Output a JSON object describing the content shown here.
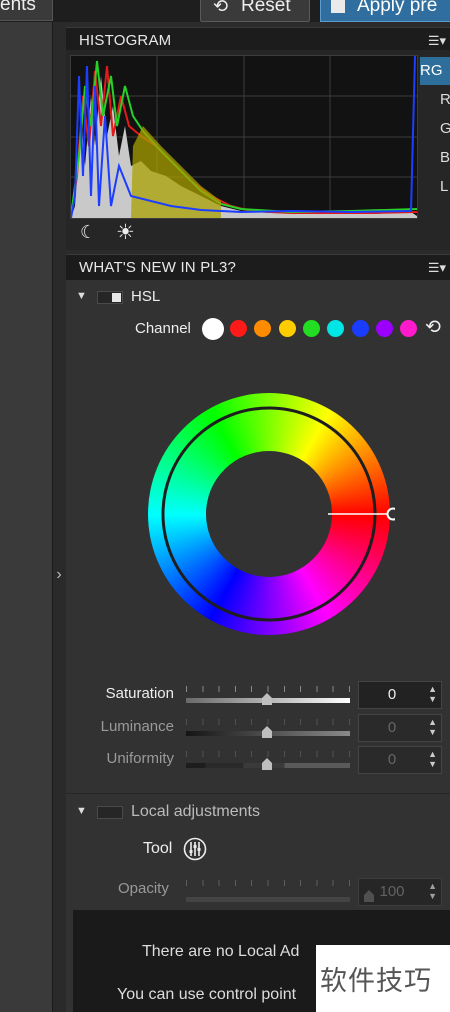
{
  "topbar": {
    "left_tab_label": "ents",
    "reset_label": "Reset",
    "reset_icon": "reset-arrow-icon",
    "apply_label": "Apply pre",
    "apply_icon": "document-icon"
  },
  "sidebar": {
    "expand_icon": "chevron-right-icon"
  },
  "histogram": {
    "title": "HISTOGRAM",
    "menu_icon": "panel-menu-icon",
    "channels": [
      "RG",
      "R",
      "G",
      "B",
      "L"
    ],
    "selected_channel": "RG",
    "shadow_clip_icon": "moon-icon",
    "highlight_clip_icon": "sun-icon"
  },
  "whats_new": {
    "title": "WHAT'S NEW IN PL3?",
    "menu_icon": "panel-menu-icon",
    "hsl": {
      "label": "HSL",
      "channel_label": "Channel",
      "channels": [
        {
          "name": "all",
          "color": "#ffffff"
        },
        {
          "name": "red",
          "color": "#ff1a1a"
        },
        {
          "name": "orange",
          "color": "#ff8c00"
        },
        {
          "name": "yellow",
          "color": "#ffcc00"
        },
        {
          "name": "green",
          "color": "#22dd22"
        },
        {
          "name": "cyan",
          "color": "#00e5e5"
        },
        {
          "name": "blue",
          "color": "#1a3cff"
        },
        {
          "name": "purple",
          "color": "#9b00ff"
        },
        {
          "name": "magenta",
          "color": "#ff1acb"
        }
      ],
      "selected_channel": "all",
      "reset_icon": "undo-icon",
      "sliders": [
        {
          "label": "Saturation",
          "value": "0",
          "enabled": true
        },
        {
          "label": "Luminance",
          "value": "0",
          "enabled": false
        },
        {
          "label": "Uniformity",
          "value": "0",
          "enabled": false
        }
      ]
    },
    "local_adjustments": {
      "label": "Local adjustments",
      "tool_label": "Tool",
      "tool_icon": "control-point-icon",
      "opacity_label": "Opacity",
      "opacity_value": "100",
      "empty_message_line1": "There are no Local Ad",
      "empty_message_line2": "You can use control point"
    }
  },
  "watermark": {
    "text": "软件技巧"
  }
}
